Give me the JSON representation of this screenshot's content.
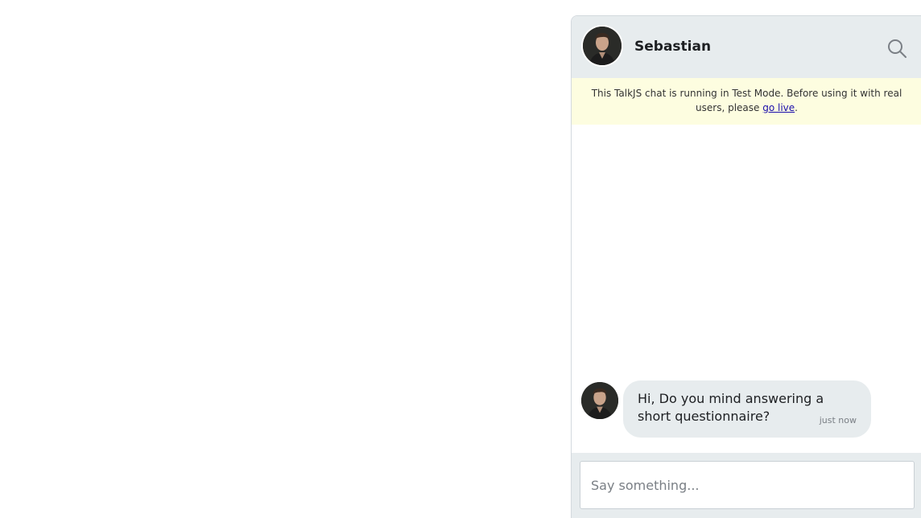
{
  "header": {
    "name": "Sebastian",
    "search_icon": "search-icon"
  },
  "banner": {
    "text": "This TalkJS chat is running in Test Mode. Before using it with real users, please ",
    "link_label": "go live",
    "suffix": "."
  },
  "messages": [
    {
      "sender": "Sebastian",
      "text": "Hi, Do you mind answering a short questionnaire?",
      "time": "just now"
    }
  ],
  "composer": {
    "placeholder": "Say something..."
  },
  "colors": {
    "header_bg": "#e7ecee",
    "banner_bg": "#fdfde0",
    "bubble_bg": "#e7ecee",
    "link": "#1a0dab"
  }
}
